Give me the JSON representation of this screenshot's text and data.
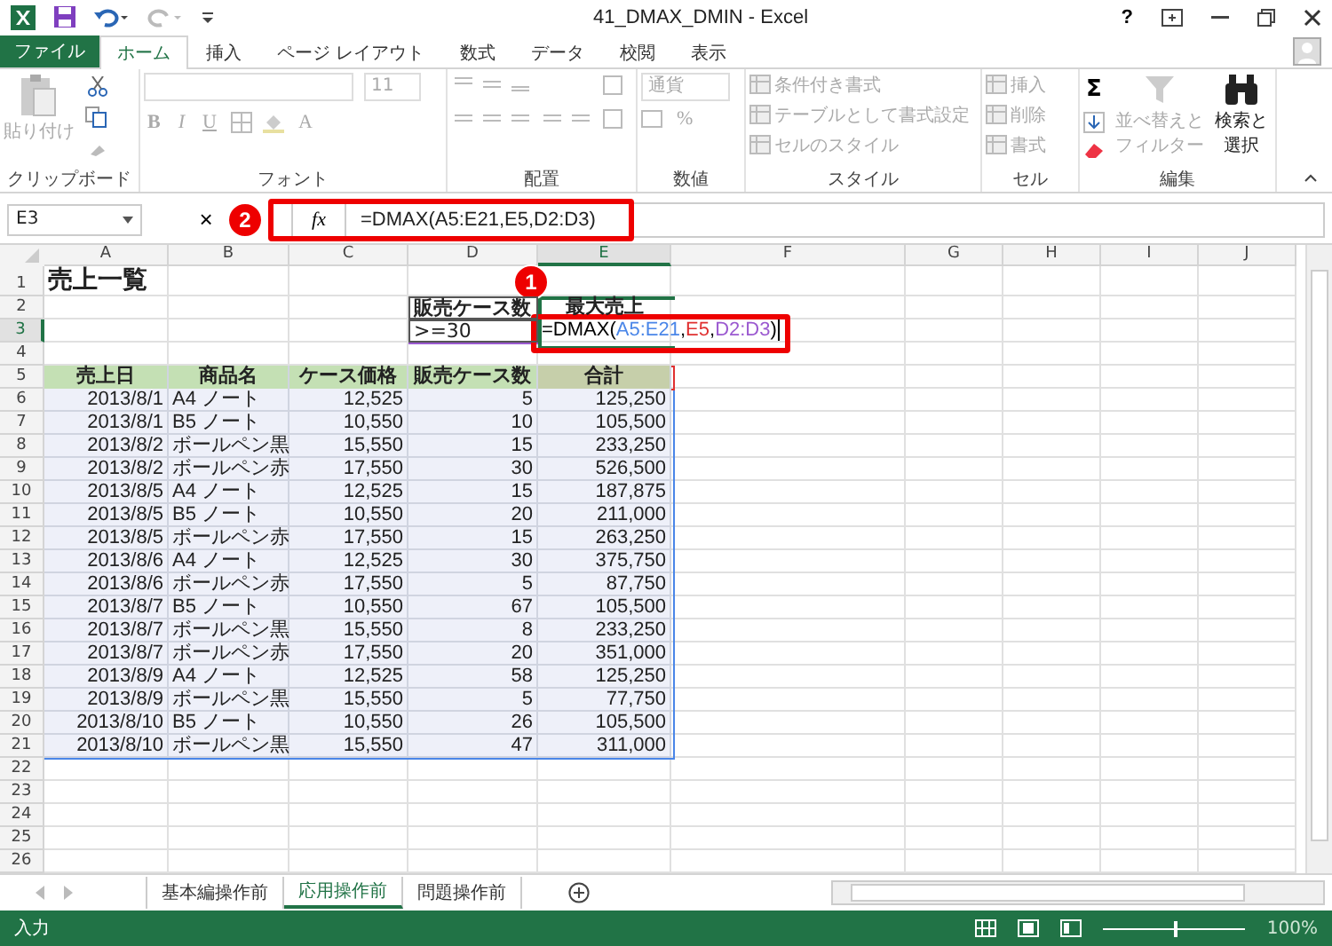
{
  "window": {
    "title": "41_DMAX_DMIN - Excel",
    "help": "?"
  },
  "tabs": [
    {
      "label": "ファイル",
      "kind": "file",
      "selected": false
    },
    {
      "label": "ホーム",
      "kind": "tab",
      "selected": true
    },
    {
      "label": "挿入",
      "kind": "tab",
      "selected": false
    },
    {
      "label": "ページ レイアウト",
      "kind": "tab",
      "selected": false
    },
    {
      "label": "数式",
      "kind": "tab",
      "selected": false
    },
    {
      "label": "データ",
      "kind": "tab",
      "selected": false
    },
    {
      "label": "校閲",
      "kind": "tab",
      "selected": false
    },
    {
      "label": "表示",
      "kind": "tab",
      "selected": false
    }
  ],
  "ribbon": {
    "groups": [
      {
        "kind": "clipboard",
        "label": "クリップボード",
        "paste": "貼り付け"
      },
      {
        "kind": "font",
        "label": "フォント",
        "size": "11",
        "styles": [
          "B",
          "I",
          "U"
        ],
        "font_color": "A"
      },
      {
        "kind": "alignment",
        "label": "配置"
      },
      {
        "kind": "number",
        "label": "数値",
        "format": "通貨",
        "percent": "%"
      },
      {
        "kind": "styles",
        "label": "スタイル",
        "items": [
          "条件付き書式",
          "テーブルとして書式設定",
          "セルのスタイル"
        ]
      },
      {
        "kind": "cells",
        "label": "セル",
        "items": [
          "挿入",
          "削除",
          "書式"
        ]
      },
      {
        "kind": "editing",
        "label": "編集",
        "sum": "Σ",
        "items": [
          {
            "lines": [
              "並べ替えと",
              "フィルター"
            ],
            "disabled": true
          },
          {
            "lines": [
              "検索と",
              "選択"
            ],
            "disabled": false
          }
        ]
      }
    ]
  },
  "formula_bar": {
    "name_box": "E3",
    "cancel": "×",
    "function_label": "fx",
    "formula": "=DMAX(A5:E21,E5,D2:D3)"
  },
  "callouts": [
    "1",
    "2"
  ],
  "sheet": {
    "columns": [
      {
        "label": "A",
        "selected": false
      },
      {
        "label": "B",
        "selected": false
      },
      {
        "label": "C",
        "selected": false
      },
      {
        "label": "D",
        "selected": false
      },
      {
        "label": "E",
        "selected": true
      },
      {
        "label": "F",
        "selected": false
      },
      {
        "label": "G",
        "selected": false
      },
      {
        "label": "H",
        "selected": false
      },
      {
        "label": "I",
        "selected": false
      },
      {
        "label": "J",
        "selected": false
      }
    ],
    "rows": [
      {
        "label": "1",
        "selected": false
      },
      {
        "label": "2",
        "selected": false
      },
      {
        "label": "3",
        "selected": true
      },
      {
        "label": "4",
        "selected": false
      },
      {
        "label": "5",
        "selected": false
      },
      {
        "label": "6",
        "selected": false
      },
      {
        "label": "7",
        "selected": false
      },
      {
        "label": "8",
        "selected": false
      },
      {
        "label": "9",
        "selected": false
      },
      {
        "label": "10",
        "selected": false
      },
      {
        "label": "11",
        "selected": false
      },
      {
        "label": "12",
        "selected": false
      },
      {
        "label": "13",
        "selected": false
      },
      {
        "label": "14",
        "selected": false
      },
      {
        "label": "15",
        "selected": false
      },
      {
        "label": "16",
        "selected": false
      },
      {
        "label": "17",
        "selected": false
      },
      {
        "label": "18",
        "selected": false
      },
      {
        "label": "19",
        "selected": false
      },
      {
        "label": "20",
        "selected": false
      },
      {
        "label": "21",
        "selected": false
      },
      {
        "label": "22",
        "selected": false
      },
      {
        "label": "23",
        "selected": false
      },
      {
        "label": "24",
        "selected": false
      },
      {
        "label": "25",
        "selected": false
      },
      {
        "label": "26",
        "selected": false
      }
    ],
    "title": "売上一覧",
    "criteria": {
      "header": "販売ケース数",
      "value": ">=30"
    },
    "result": {
      "header": "最大売上",
      "segments": [
        {
          "text": "=DMAX(",
          "color": "#000000"
        },
        {
          "text": "A5:E21",
          "color": "#4a86e8"
        },
        {
          "text": ",",
          "color": "#000000"
        },
        {
          "text": "E5",
          "color": "#e03030"
        },
        {
          "text": ",",
          "color": "#000000"
        },
        {
          "text": "D2:D3",
          "color": "#9b59d0"
        },
        {
          "text": ")",
          "color": "#000000"
        }
      ]
    },
    "table": {
      "columns": [
        "売上日",
        "商品名",
        "ケース価格",
        "販売ケース数",
        "合計"
      ],
      "rows": [
        [
          "2013/8/1",
          "A4 ノート",
          "12,525",
          "5",
          "125,250"
        ],
        [
          "2013/8/1",
          "B5 ノート",
          "10,550",
          "10",
          "105,500"
        ],
        [
          "2013/8/2",
          "ボールペン黒",
          "15,550",
          "15",
          "233,250"
        ],
        [
          "2013/8/2",
          "ボールペン赤",
          "17,550",
          "30",
          "526,500"
        ],
        [
          "2013/8/5",
          "A4 ノート",
          "12,525",
          "15",
          "187,875"
        ],
        [
          "2013/8/5",
          "B5 ノート",
          "10,550",
          "20",
          "211,000"
        ],
        [
          "2013/8/5",
          "ボールペン赤",
          "17,550",
          "15",
          "263,250"
        ],
        [
          "2013/8/6",
          "A4 ノート",
          "12,525",
          "30",
          "375,750"
        ],
        [
          "2013/8/6",
          "ボールペン赤",
          "17,550",
          "5",
          "87,750"
        ],
        [
          "2013/8/7",
          "B5 ノート",
          "10,550",
          "67",
          "105,500"
        ],
        [
          "2013/8/7",
          "ボールペン黒",
          "15,550",
          "8",
          "233,250"
        ],
        [
          "2013/8/7",
          "ボールペン赤",
          "17,550",
          "20",
          "351,000"
        ],
        [
          "2013/8/9",
          "A4 ノート",
          "12,525",
          "58",
          "125,250"
        ],
        [
          "2013/8/9",
          "ボールペン黒",
          "15,550",
          "5",
          "77,750"
        ],
        [
          "2013/8/10",
          "B5 ノート",
          "10,550",
          "26",
          "105,500"
        ],
        [
          "2013/8/10",
          "ボールペン黒",
          "15,550",
          "47",
          "311,000"
        ]
      ]
    }
  },
  "sheet_tabs": [
    {
      "label": "基本編操作前",
      "selected": false
    },
    {
      "label": "応用操作前",
      "selected": true
    },
    {
      "label": "問題操作前",
      "selected": false
    }
  ],
  "status_bar": {
    "mode": "入力",
    "zoom": {
      "level": 0.5,
      "reading": "100%"
    }
  }
}
